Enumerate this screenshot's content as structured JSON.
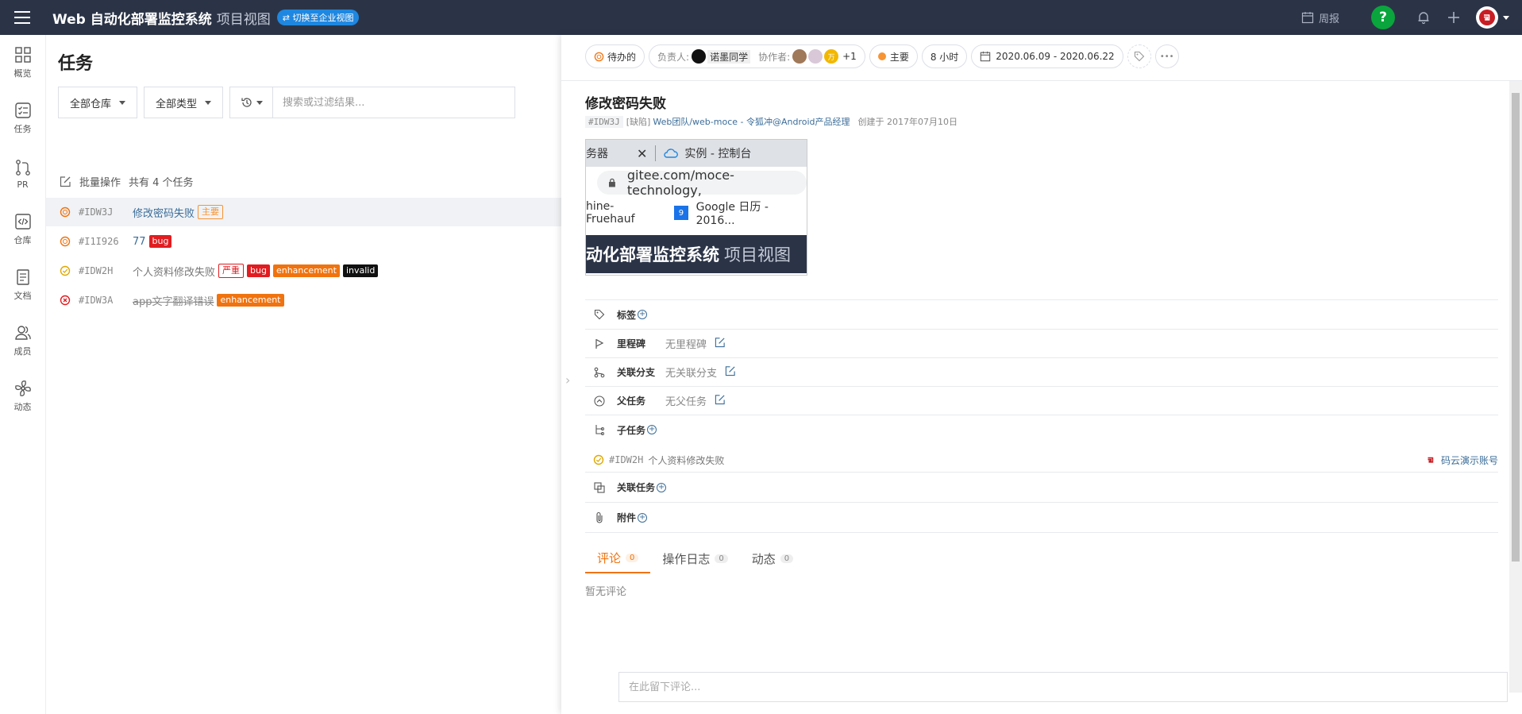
{
  "header": {
    "app_title": "Web 自动化部署监控系统",
    "view_name": "项目视图",
    "switch_label": "⇄ 切换至企业视图",
    "weekly_label": "周报",
    "help_label": "?"
  },
  "sidebar": {
    "items": [
      {
        "label": "概览",
        "icon": "grid-icon"
      },
      {
        "label": "任务",
        "icon": "task-list-icon"
      },
      {
        "label": "PR",
        "icon": "pull-request-icon"
      },
      {
        "label": "仓库",
        "icon": "code-repo-icon"
      },
      {
        "label": "文档",
        "icon": "document-icon"
      },
      {
        "label": "成员",
        "icon": "members-icon"
      },
      {
        "label": "动态",
        "icon": "activity-icon"
      }
    ]
  },
  "tasks_panel": {
    "title": "任务",
    "repo_filter": "全部仓库",
    "type_filter": "全部类型",
    "search_placeholder": "搜索或过滤结果...",
    "batch_label": "批量操作",
    "count_label": "共有 4 个任务",
    "tasks": [
      {
        "ident": "#IDW3J",
        "title": "修改密码失败",
        "status": "todo",
        "tags": [
          {
            "text": "主要",
            "kind": "main"
          }
        ]
      },
      {
        "ident": "#I1I926",
        "title": "77",
        "status": "todo",
        "tags": [
          {
            "text": "bug",
            "kind": "bug"
          }
        ]
      },
      {
        "ident": "#IDW2H",
        "title": "个人资料修改失败",
        "status": "done",
        "tags": [
          {
            "text": "严重",
            "kind": "sev"
          },
          {
            "text": "bug",
            "kind": "bug"
          },
          {
            "text": "enhancement",
            "kind": "enh"
          },
          {
            "text": "invalid",
            "kind": "inv"
          }
        ]
      },
      {
        "ident": "#IDW3A",
        "title": "app文字翻译错误",
        "status": "rejected",
        "tags": [
          {
            "text": "enhancement",
            "kind": "enh"
          }
        ]
      }
    ]
  },
  "detail": {
    "status": "待办的",
    "assignee_label": "负责人:",
    "assignee_name": "诺墨同学",
    "collab_label": "协作者:",
    "collab_avatar_letter": "万",
    "collab_more": "+1",
    "priority": "主要",
    "duration": "8 小时",
    "date_range": "2020.06.09 - 2020.06.22",
    "more_label": "•••",
    "title": "修改密码失败",
    "ident": "#IDW3J",
    "type_label": "[缺陷]",
    "repo_link": "Web团队/web-moce - 令狐冲@Android产品经理",
    "created": "创建于 2017年07月10日",
    "screenshot": {
      "tab1": "务器",
      "tab2": "实例 - 控制台",
      "url": "gitee.com/moce-technology,",
      "bm1": "hine-Fruehauf",
      "bm2": "Google 日历 - 2016...",
      "bm2_num": "9",
      "banner": "动化部署监控系统",
      "banner_sub": "项目视图"
    },
    "fields": {
      "tags_label": "标签",
      "milestone_label": "里程碑",
      "milestone_value": "无里程碑",
      "branch_label": "关联分支",
      "branch_value": "无关联分支",
      "parent_label": "父任务",
      "parent_value": "无父任务",
      "subtask_label": "子任务",
      "related_label": "关联任务",
      "attach_label": "附件"
    },
    "subtask": {
      "ident": "#IDW2H",
      "title": "个人资料修改失败",
      "user": "码云演示账号"
    },
    "tabs": [
      {
        "label": "评论",
        "count": "0"
      },
      {
        "label": "操作日志",
        "count": "0"
      },
      {
        "label": "动态",
        "count": "0"
      }
    ],
    "no_comment": "暂无评论",
    "comment_placeholder": "在此留下评论..."
  },
  "colors": {
    "topbar": "#2b3447",
    "accent_orange": "#f0730f",
    "link_blue": "#3b6d99",
    "gitee_red": "#c71d23"
  }
}
